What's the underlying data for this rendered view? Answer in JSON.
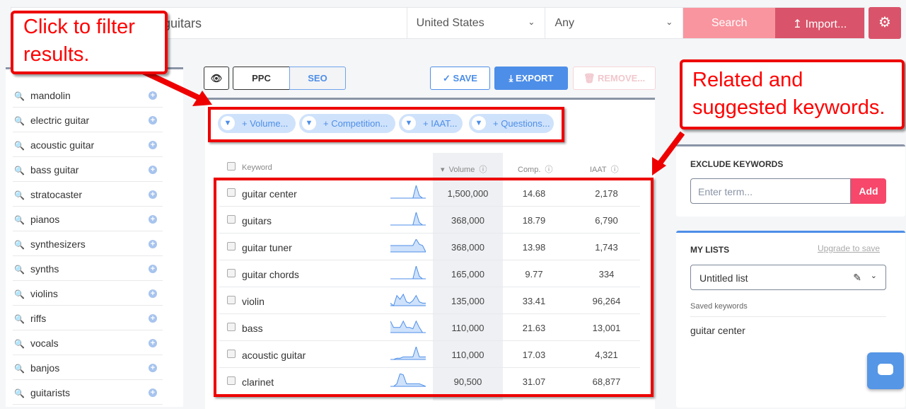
{
  "search": {
    "query": "guitars",
    "country": "United States",
    "language": "Any",
    "search_label": "Search",
    "import_label": "Import..."
  },
  "sidebar": {
    "items": [
      "mandolin",
      "electric guitar",
      "acoustic guitar",
      "bass guitar",
      "stratocaster",
      "pianos",
      "synthesizers",
      "synths",
      "violins",
      "riffs",
      "vocals",
      "banjos",
      "guitarists"
    ]
  },
  "toolbar": {
    "ppc": "PPC",
    "seo": "SEO",
    "save": "SAVE",
    "export": "EXPORT",
    "remove": "REMOVE..."
  },
  "filters": [
    "+ Volume...",
    "+ Competition...",
    "+ IAAT...",
    "+ Questions..."
  ],
  "table": {
    "headers": {
      "keyword": "Keyword",
      "volume": "Volume",
      "comp": "Comp.",
      "iaat": "IAAT"
    },
    "rows": [
      {
        "keyword": "guitar center",
        "volume": "1,500,000",
        "comp": "14.68",
        "iaat": "2,178",
        "trend": [
          0,
          0,
          0,
          0,
          0,
          0,
          0,
          0,
          1,
          0.2,
          0,
          0
        ]
      },
      {
        "keyword": "guitars",
        "volume": "368,000",
        "comp": "18.79",
        "iaat": "6,790",
        "trend": [
          0,
          0,
          0,
          0,
          0,
          0,
          0,
          0,
          1,
          0.2,
          0,
          0
        ]
      },
      {
        "keyword": "guitar tuner",
        "volume": "368,000",
        "comp": "13.98",
        "iaat": "1,743",
        "trend": [
          0.5,
          0.5,
          0.5,
          0.5,
          0.5,
          0.5,
          0.5,
          0.5,
          1,
          0.6,
          0.5,
          0
        ]
      },
      {
        "keyword": "guitar chords",
        "volume": "165,000",
        "comp": "9.77",
        "iaat": "334",
        "trend": [
          0,
          0,
          0,
          0,
          0,
          0,
          0,
          0,
          1,
          0.2,
          0,
          0
        ]
      },
      {
        "keyword": "violin",
        "volume": "135,000",
        "comp": "33.41",
        "iaat": "96,264",
        "trend": [
          0.2,
          0,
          0.8,
          0.5,
          0.9,
          0.3,
          0.2,
          0.4,
          0.8,
          0.3,
          0.2,
          0.2
        ]
      },
      {
        "keyword": "bass",
        "volume": "110,000",
        "comp": "21.63",
        "iaat": "13,001",
        "trend": [
          0.9,
          0.4,
          0.4,
          0.4,
          0.9,
          0.4,
          0.4,
          0.3,
          0.9,
          0.4,
          0,
          0
        ]
      },
      {
        "keyword": "acoustic guitar",
        "volume": "110,000",
        "comp": "17.03",
        "iaat": "4,321",
        "trend": [
          0,
          0,
          0.1,
          0.1,
          0.2,
          0.2,
          0.2,
          0.2,
          1,
          0.2,
          0.2,
          0.2
        ]
      },
      {
        "keyword": "clarinet",
        "volume": "90,500",
        "comp": "31.07",
        "iaat": "68,877",
        "trend": [
          0,
          0,
          0.2,
          1,
          0.9,
          0.2,
          0.2,
          0.2,
          0.2,
          0.2,
          0.1,
          0
        ]
      }
    ]
  },
  "exclude": {
    "title": "EXCLUDE KEYWORDS",
    "placeholder": "Enter term...",
    "add": "Add"
  },
  "lists": {
    "title": "MY LISTS",
    "upgrade": "Upgrade to save",
    "selected": "Untitled list",
    "saved_label": "Saved keywords",
    "saved": [
      "guitar center"
    ]
  },
  "callouts": {
    "filter": "Click to filter results.",
    "related": "Related and suggested keywords."
  },
  "colors": {
    "accent": "#4d8ee8",
    "search": "#f9959f",
    "import": "#d9546a",
    "add": "#f7476a",
    "annotation": "#ee0000"
  }
}
